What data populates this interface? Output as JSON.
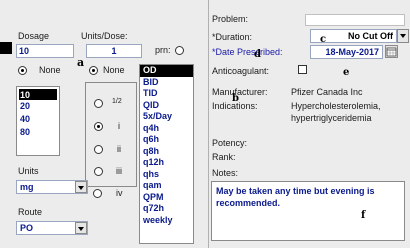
{
  "problem_label": "Problem:",
  "duration": {
    "label": "*Duration:",
    "value": "No Cut Off"
  },
  "date_prescribed": {
    "label": "*Date Prescribed:",
    "value": "18-May-2017"
  },
  "dosage": {
    "label": "Dosage",
    "value": "10",
    "none_label": "None",
    "options": [
      "10",
      "20",
      "40",
      "80"
    ]
  },
  "units_dose": {
    "label": "Units/Dose:",
    "value": "1",
    "none_label": "None",
    "fractions": [
      "1/2",
      "i",
      "ii",
      "iii",
      "iv"
    ]
  },
  "prn_label": "prn:",
  "frequency": {
    "items": [
      "OD",
      "BID",
      "TID",
      "QID",
      "5x/Day",
      "q4h",
      "q6h",
      "q8h",
      "q12h",
      "qhs",
      "qam",
      "QPM",
      "q72h",
      "weekly"
    ]
  },
  "anticoagulant_label": "Anticoagulant:",
  "manufacturer": {
    "label": "Manufacturer:",
    "value": "Pfizer Canada Inc"
  },
  "indications": {
    "label": "Indications:",
    "line1": "Hypercholesterolemia,",
    "line2": "hypertriglyceridemia"
  },
  "potency_label": "Potency:",
  "rank_label": "Rank:",
  "notes": {
    "label": "Notes:",
    "text": "May be taken any time but evening is recommended."
  },
  "units": {
    "label": "Units",
    "value": "mg"
  },
  "route": {
    "label": "Route",
    "value": "PO"
  },
  "markers": {
    "a": "a",
    "b": "b",
    "c": "c",
    "d": "d",
    "e": "e",
    "f": "f"
  }
}
